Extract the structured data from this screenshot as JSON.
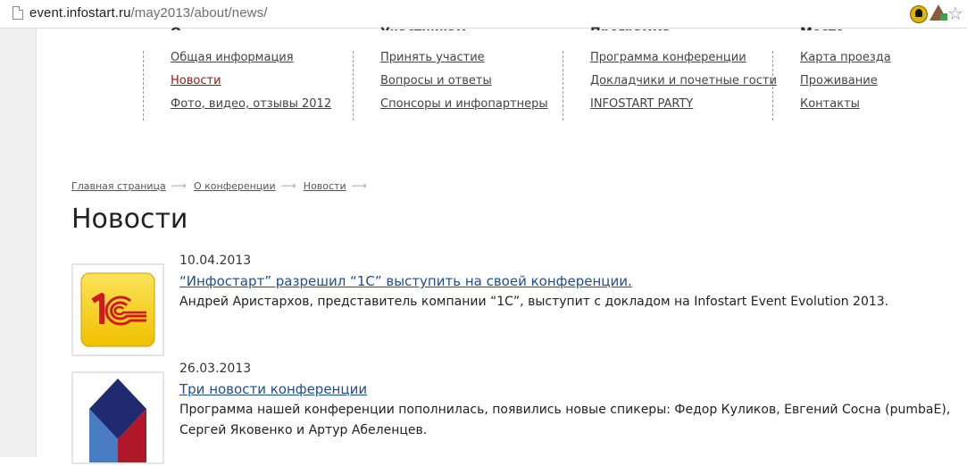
{
  "browser": {
    "url_host": "event.infostart.ru",
    "url_path": "/may2013/about/news/"
  },
  "menu": {
    "columns": [
      {
        "heading": "О конференции",
        "items": [
          "Общая информация",
          "Новости",
          "Фото, видео, отзывы 2012"
        ],
        "active": 1
      },
      {
        "heading": "Участникам",
        "items": [
          "Принять участие",
          "Вопросы и ответы",
          "Спонсоры и инфопартнеры"
        ],
        "active": -1
      },
      {
        "heading": "Программа",
        "items": [
          "Программа конференции",
          "Докладчики и почетные гости",
          "INFOSTART PARTY"
        ],
        "active": -1
      },
      {
        "heading": "Место проведения",
        "items": [
          "Карта проезда",
          "Проживание",
          "Контакты"
        ],
        "active": -1
      }
    ]
  },
  "breadcrumbs": [
    "Главная страница",
    "О конференции",
    "Новости"
  ],
  "page_title": "Новости",
  "news": [
    {
      "date": "10.04.2013",
      "title": "“Инфостарт” разрешил “1С” выступить на своей конференции.",
      "text": "Андрей Аристархов, представитель  компании “1С”, выступит с докладом на Infostart Event Evolution 2013.",
      "thumb_icon": "1c-logo"
    },
    {
      "date": "26.03.2013",
      "title": "Три новости конференции",
      "text": "Программа нашей конференции пополнилась, появились новые спикеры:  Федор Куликов, Евгений Сосна (pumbaE), Сергей Яковенко и Артур Абеленцев.",
      "thumb_icon": "infostart-diamond-logo"
    }
  ],
  "colors": {
    "link": "#1d4e8f",
    "active_menu": "#8b1a1a",
    "logo_1c_yellow": "#f5d21e",
    "logo_1c_red": "#d0191b",
    "diamond_navy": "#1f2b6e",
    "diamond_blue": "#4a7cc4",
    "diamond_red": "#b0182a"
  }
}
